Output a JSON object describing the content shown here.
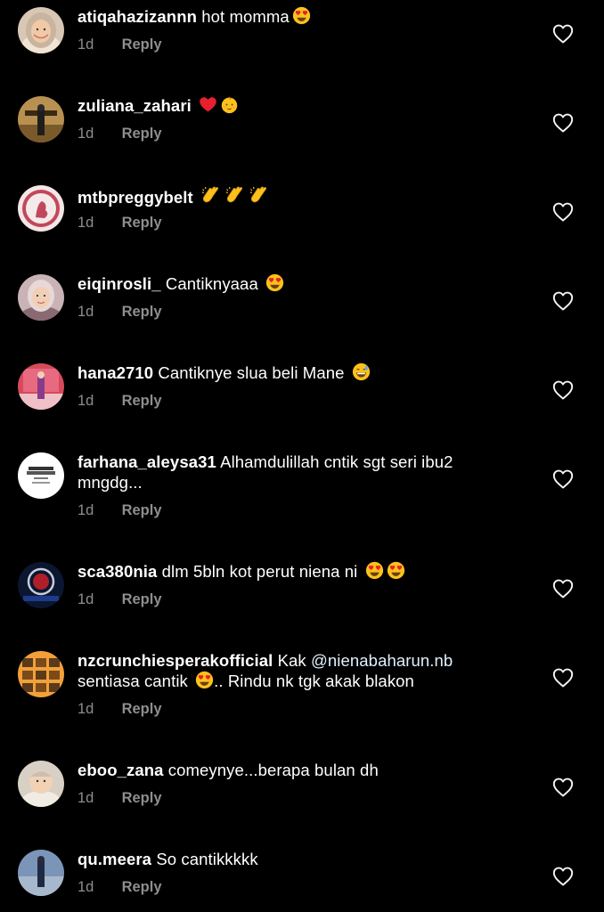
{
  "comments": [
    {
      "user": "atiqahazizannn",
      "text": "hot momma",
      "emoji": [
        "heart-eyes"
      ],
      "time": "1d",
      "reply": "Reply"
    },
    {
      "user": "zuliana_zahari",
      "text": "",
      "emoji": [
        "red-heart",
        "baby"
      ],
      "time": "1d",
      "reply": "Reply"
    },
    {
      "user": "mtbpreggybelt",
      "text": "",
      "emoji": [
        "clap",
        "clap",
        "clap"
      ],
      "time": "1d",
      "reply": "Reply"
    },
    {
      "user": "eiqinrosli_",
      "text": "Cantiknyaaa",
      "emoji": [
        "heart-eyes"
      ],
      "time": "1d",
      "reply": "Reply"
    },
    {
      "user": "hana2710",
      "text": "Cantiknye slua beli Mane",
      "emoji": [
        "grin-sweat"
      ],
      "time": "1d",
      "reply": "Reply"
    },
    {
      "user": "farhana_aleysa31",
      "text": "Alhamdulillah cntik sgt seri ibu2 mngdg...",
      "emoji": [],
      "time": "1d",
      "reply": "Reply"
    },
    {
      "user": "sca380nia",
      "text": "dlm 5bln kot perut niena ni",
      "emoji": [
        "heart-eyes",
        "heart-eyes"
      ],
      "time": "1d",
      "reply": "Reply"
    },
    {
      "user": "nzcrunchiesperakofficial",
      "text_before": "Kak",
      "mention": "@nienabaharun.nb",
      "text": "sentiasa cantik",
      "text_after": ".. Rindu nk tgk akak blakon",
      "emoji": [
        "heart-eyes"
      ],
      "time": "1d",
      "reply": "Reply"
    },
    {
      "user": "eboo_zana",
      "text": "comeynye...berapa bulan dh",
      "emoji": [],
      "time": "1d",
      "reply": "Reply"
    },
    {
      "user": "qu.meera",
      "text": "So cantikkkkk",
      "emoji": [],
      "time": "1d",
      "reply": "Reply"
    }
  ]
}
